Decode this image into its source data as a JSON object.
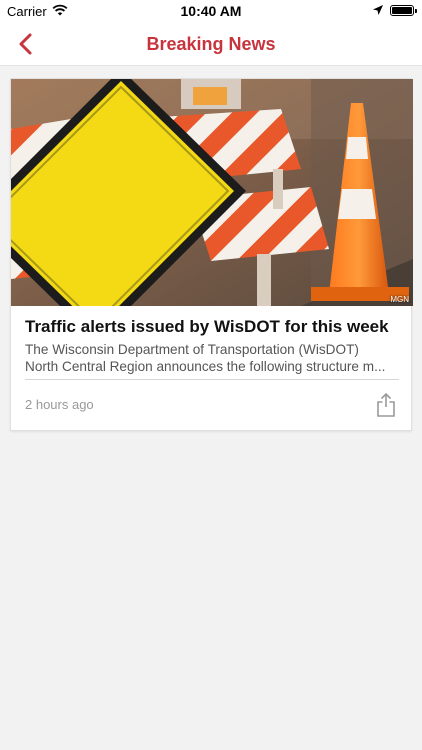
{
  "status_bar": {
    "carrier": "Carrier",
    "time": "10:40 AM",
    "icons": [
      "wifi-icon",
      "location-arrow-icon",
      "battery-icon"
    ]
  },
  "nav": {
    "title": "Breaking News",
    "back_icon": "chevron-left-icon",
    "accent_color": "#c8343d"
  },
  "articles": [
    {
      "image_alt": "Road construction barricade, yellow sign and orange traffic cone",
      "image_credit": "MGN",
      "headline": "Traffic alerts issued by WisDOT for this week",
      "summary_line1": "The Wisconsin Department of Transportation (WisDOT)",
      "summary_line2": "North Central Region announces the following structure m...",
      "timestamp": "2 hours ago",
      "share_icon": "share-icon"
    }
  ]
}
